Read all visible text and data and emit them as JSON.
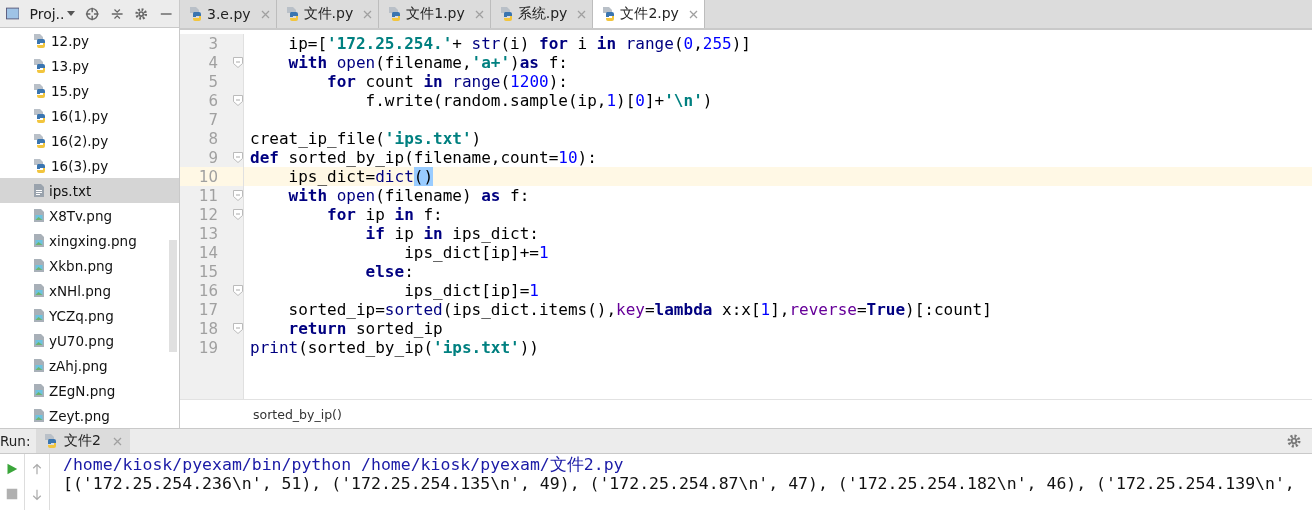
{
  "project_panel": {
    "title": "Proj..",
    "items": [
      {
        "name": "12.py",
        "kind": "python",
        "selected": false
      },
      {
        "name": "13.py",
        "kind": "python",
        "selected": false
      },
      {
        "name": "15.py",
        "kind": "python",
        "selected": false
      },
      {
        "name": "16(1).py",
        "kind": "python",
        "selected": false
      },
      {
        "name": "16(2).py",
        "kind": "python",
        "selected": false
      },
      {
        "name": "16(3).py",
        "kind": "python",
        "selected": false
      },
      {
        "name": "ips.txt",
        "kind": "text",
        "selected": true
      },
      {
        "name": "X8Tv.png",
        "kind": "image",
        "selected": false
      },
      {
        "name": "xingxing.png",
        "kind": "image",
        "selected": false
      },
      {
        "name": "Xkbn.png",
        "kind": "image",
        "selected": false
      },
      {
        "name": "xNHl.png",
        "kind": "image",
        "selected": false
      },
      {
        "name": "YCZq.png",
        "kind": "image",
        "selected": false
      },
      {
        "name": "yU70.png",
        "kind": "image",
        "selected": false
      },
      {
        "name": "zAhj.png",
        "kind": "image",
        "selected": false
      },
      {
        "name": "ZEgN.png",
        "kind": "image",
        "selected": false
      },
      {
        "name": "Zeyt.png",
        "kind": "image",
        "selected": false
      }
    ]
  },
  "editor_tabs": [
    {
      "label": "3.e.py",
      "selected": false
    },
    {
      "label": "文件.py",
      "selected": false
    },
    {
      "label": "文件1.py",
      "selected": false
    },
    {
      "label": "系统.py",
      "selected": false
    },
    {
      "label": "文件2.py",
      "selected": true
    }
  ],
  "editor": {
    "lines": [
      {
        "number": "3",
        "current": false,
        "fold": false,
        "tokens": [
          {
            "kind": "plain",
            "t": "    ip=["
          },
          {
            "kind": "str",
            "t": "'172.25.254.'"
          },
          {
            "kind": "plain",
            "t": "+ "
          },
          {
            "kind": "builtin",
            "t": "str"
          },
          {
            "kind": "plain",
            "t": "(i) "
          },
          {
            "kind": "kw",
            "t": "for"
          },
          {
            "kind": "plain",
            "t": " i "
          },
          {
            "kind": "kw",
            "t": "in"
          },
          {
            "kind": "builtin",
            "t": " range"
          },
          {
            "kind": "plain",
            "t": "("
          },
          {
            "kind": "num",
            "t": "0"
          },
          {
            "kind": "plain",
            "t": ","
          },
          {
            "kind": "num",
            "t": "255"
          },
          {
            "kind": "plain",
            "t": ")]"
          }
        ]
      },
      {
        "number": "4",
        "current": false,
        "fold": true,
        "tokens": [
          {
            "kind": "kw",
            "t": "    with"
          },
          {
            "kind": "builtin",
            "t": " open"
          },
          {
            "kind": "plain",
            "t": "(filename,"
          },
          {
            "kind": "str",
            "t": "'a+'"
          },
          {
            "kind": "plain",
            "t": ")"
          },
          {
            "kind": "kw",
            "t": "as"
          },
          {
            "kind": "plain",
            "t": " f:"
          }
        ]
      },
      {
        "number": "5",
        "current": false,
        "fold": false,
        "tokens": [
          {
            "kind": "kw",
            "t": "        for"
          },
          {
            "kind": "plain",
            "t": " count "
          },
          {
            "kind": "kw",
            "t": "in"
          },
          {
            "kind": "builtin",
            "t": " range"
          },
          {
            "kind": "plain",
            "t": "("
          },
          {
            "kind": "num",
            "t": "1200"
          },
          {
            "kind": "plain",
            "t": "):"
          }
        ]
      },
      {
        "number": "6",
        "current": false,
        "fold": true,
        "tokens": [
          {
            "kind": "plain",
            "t": "            f.write(random.sample(ip,"
          },
          {
            "kind": "num",
            "t": "1"
          },
          {
            "kind": "plain",
            "t": ")["
          },
          {
            "kind": "num",
            "t": "0"
          },
          {
            "kind": "plain",
            "t": "]+"
          },
          {
            "kind": "str",
            "t": "'\\n'"
          },
          {
            "kind": "plain",
            "t": ")"
          }
        ]
      },
      {
        "number": "7",
        "current": false,
        "fold": false
      },
      {
        "number": "8",
        "current": false,
        "fold": false,
        "tokens": [
          {
            "kind": "plain",
            "t": "creat_ip_file("
          },
          {
            "kind": "str",
            "t": "'ips.txt'"
          },
          {
            "kind": "plain",
            "t": ")"
          }
        ]
      },
      {
        "number": "9",
        "current": false,
        "fold": true,
        "tokens": [
          {
            "kind": "kw",
            "t": "def"
          },
          {
            "kind": "plain",
            "t": " sorted_by_ip(filename,count="
          },
          {
            "kind": "num",
            "t": "10"
          },
          {
            "kind": "plain",
            "t": "):"
          }
        ]
      },
      {
        "number": "10",
        "current": true,
        "fold": false,
        "tokens": [
          {
            "kind": "plain",
            "t": "    ips_dict="
          },
          {
            "kind": "builtin",
            "t": "dict"
          },
          {
            "kind": "match",
            "t": "()"
          }
        ]
      },
      {
        "number": "11",
        "current": false,
        "fold": true,
        "tokens": [
          {
            "kind": "kw",
            "t": "    with"
          },
          {
            "kind": "builtin",
            "t": " open"
          },
          {
            "kind": "plain",
            "t": "(filename) "
          },
          {
            "kind": "kw",
            "t": "as"
          },
          {
            "kind": "plain",
            "t": " f:"
          }
        ]
      },
      {
        "number": "12",
        "current": false,
        "fold": true,
        "tokens": [
          {
            "kind": "kw",
            "t": "        for"
          },
          {
            "kind": "plain",
            "t": " ip "
          },
          {
            "kind": "kw",
            "t": "in"
          },
          {
            "kind": "plain",
            "t": " f:"
          }
        ]
      },
      {
        "number": "13",
        "current": false,
        "fold": false,
        "tokens": [
          {
            "kind": "kw",
            "t": "            if"
          },
          {
            "kind": "plain",
            "t": " ip "
          },
          {
            "kind": "kw",
            "t": "in"
          },
          {
            "kind": "plain",
            "t": " ips_dict:"
          }
        ]
      },
      {
        "number": "14",
        "current": false,
        "fold": false,
        "tokens": [
          {
            "kind": "plain",
            "t": "                ips_dict[ip]+="
          },
          {
            "kind": "num",
            "t": "1"
          }
        ]
      },
      {
        "number": "15",
        "current": false,
        "fold": false,
        "tokens": [
          {
            "kind": "kw",
            "t": "            else"
          },
          {
            "kind": "plain",
            "t": ":"
          }
        ]
      },
      {
        "number": "16",
        "current": false,
        "fold": true,
        "tokens": [
          {
            "kind": "plain",
            "t": "                ips_dict[ip]="
          },
          {
            "kind": "num",
            "t": "1"
          }
        ]
      },
      {
        "number": "17",
        "current": false,
        "fold": false,
        "tokens": [
          {
            "kind": "plain",
            "t": "    sorted_ip="
          },
          {
            "kind": "builtin",
            "t": "sorted"
          },
          {
            "kind": "plain",
            "t": "(ips_dict.items(),"
          },
          {
            "kind": "kwarg",
            "t": "key"
          },
          {
            "kind": "plain",
            "t": "="
          },
          {
            "kind": "kw",
            "t": "lambda"
          },
          {
            "kind": "plain",
            "t": " x:x["
          },
          {
            "kind": "num",
            "t": "1"
          },
          {
            "kind": "plain",
            "t": "],"
          },
          {
            "kind": "kwarg",
            "t": "reverse"
          },
          {
            "kind": "plain",
            "t": "="
          },
          {
            "kind": "kw",
            "t": "True"
          },
          {
            "kind": "plain",
            "t": ")[:count]"
          }
        ]
      },
      {
        "number": "18",
        "current": false,
        "fold": true,
        "tokens": [
          {
            "kind": "kw",
            "t": "    return"
          },
          {
            "kind": "plain",
            "t": " sorted_ip"
          }
        ]
      },
      {
        "number": "19",
        "current": false,
        "fold": false,
        "tokens": [
          {
            "kind": "builtin",
            "t": "print"
          },
          {
            "kind": "plain",
            "t": "(sorted_by_ip("
          },
          {
            "kind": "str",
            "t": "'ips.txt'"
          },
          {
            "kind": "plain",
            "t": "))"
          }
        ]
      }
    ],
    "breadcrumb": "sorted_by_ip()"
  },
  "run_panel": {
    "label": "Run:",
    "tab": "文件2",
    "output": [
      {
        "kind": "command",
        "text": "/home/kiosk/pyexam/bin/python /home/kiosk/pyexam/文件2.py"
      },
      {
        "kind": "stdout",
        "text": "[('172.25.254.236\\n', 51), ('172.25.254.135\\n', 49), ('172.25.254.87\\n', 47), ('172.25.254.182\\n', 46), ('172.25.254.139\\n',"
      }
    ]
  }
}
